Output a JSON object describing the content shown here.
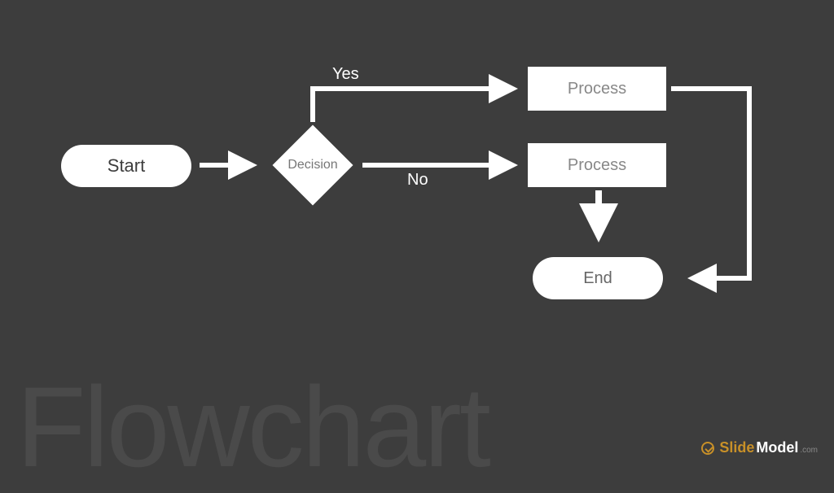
{
  "watermark": "Flowchart",
  "brand": {
    "part1": "Slide",
    "part2": "Model",
    "suffix": ".com"
  },
  "nodes": {
    "start": "Start",
    "decision": "Decision",
    "process1": "Process",
    "process2": "Process",
    "end": "End"
  },
  "labels": {
    "yes": "Yes",
    "no": "No"
  },
  "chart_data": {
    "type": "flowchart",
    "nodes": [
      {
        "id": "start",
        "type": "terminator",
        "label": "Start"
      },
      {
        "id": "decision",
        "type": "decision",
        "label": "Decision"
      },
      {
        "id": "process1",
        "type": "process",
        "label": "Process"
      },
      {
        "id": "process2",
        "type": "process",
        "label": "Process"
      },
      {
        "id": "end",
        "type": "terminator",
        "label": "End"
      }
    ],
    "edges": [
      {
        "from": "start",
        "to": "decision"
      },
      {
        "from": "decision",
        "to": "process1",
        "label": "Yes"
      },
      {
        "from": "decision",
        "to": "process2",
        "label": "No"
      },
      {
        "from": "process2",
        "to": "end"
      },
      {
        "from": "process1",
        "to": "end"
      }
    ]
  }
}
